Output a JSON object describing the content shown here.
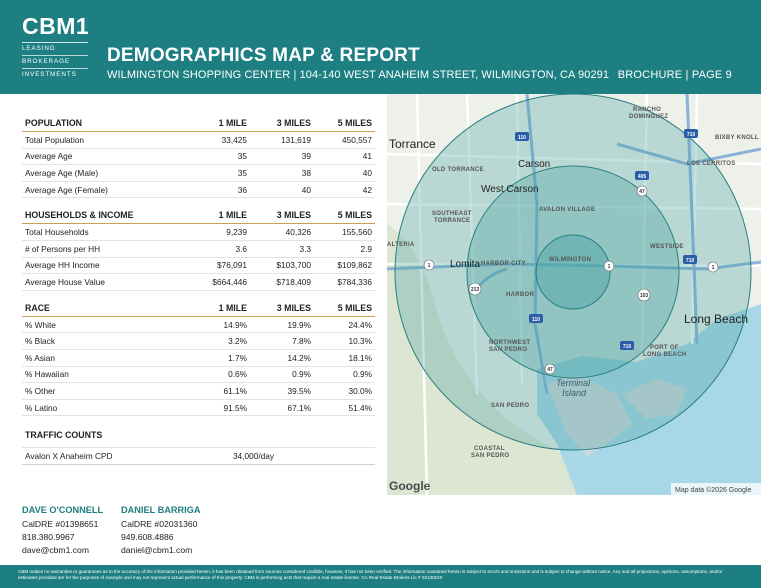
{
  "header": {
    "logo": {
      "name": "CBM1",
      "lines": [
        "LEASING",
        "BROKERAGE",
        "INVESTMENTS"
      ]
    },
    "title": "DEMOGRAPHICS MAP & REPORT",
    "subtitle": "WILMINGTON SHOPPING CENTER | 104-140 WEST ANAHEIM STREET, WILMINGTON, CA 90291",
    "page": "BROCHURE | PAGE 9",
    "accent": "#1e7f82",
    "rule_color": "#c9a24e"
  },
  "tables": {
    "population": {
      "headers": [
        "POPULATION",
        "1 MILE",
        "3 MILES",
        "5 MILES"
      ],
      "rows": [
        [
          "Total Population",
          "33,425",
          "131,619",
          "450,557"
        ],
        [
          "Average Age",
          "35",
          "39",
          "41"
        ],
        [
          "Average Age (Male)",
          "35",
          "38",
          "40"
        ],
        [
          "Average Age (Female)",
          "36",
          "40",
          "42"
        ]
      ]
    },
    "households": {
      "headers": [
        "HOUSEHOLDS & INCOME",
        "1 MILE",
        "3 MILES",
        "5 MILES"
      ],
      "rows": [
        [
          "Total Households",
          "9,239",
          "40,326",
          "155,560"
        ],
        [
          "# of Persons per HH",
          "3.6",
          "3.3",
          "2.9"
        ],
        [
          "Average HH Income",
          "$76,091",
          "$103,700",
          "$109,862"
        ],
        [
          "Average House Value",
          "$664,446",
          "$718,409",
          "$784,336"
        ]
      ]
    },
    "race": {
      "headers": [
        "RACE",
        "1 MILE",
        "3 MILES",
        "5 MILES"
      ],
      "rows": [
        [
          "% White",
          "14.9%",
          "19.9%",
          "24.4%"
        ],
        [
          "% Black",
          "3.2%",
          "7.8%",
          "10.3%"
        ],
        [
          "% Asian",
          "1.7%",
          "14.2%",
          "18.1%"
        ],
        [
          "% Hawaiian",
          "0.6%",
          "0.9%",
          "0.9%"
        ],
        [
          "% Other",
          "61.1%",
          "39.5%",
          "30.0%"
        ],
        [
          "% Latino",
          "91.5%",
          "67.1%",
          "51.4%"
        ]
      ]
    },
    "traffic": {
      "header": "TRAFFIC COUNTS",
      "label": "Avalon X Anaheim CPD",
      "value": "34,000/day"
    }
  },
  "map": {
    "place_labels": {
      "torrance": "Torrance",
      "carson": "Carson",
      "west_carson": "West Carson",
      "lomita": "Lomita",
      "long_beach": "Long Beach",
      "terminal_island_1": "Terminal",
      "terminal_island_2": "Island",
      "rancho_dominguez_1": "RANCHO",
      "rancho_dominguez_2": "DOMINGUEZ",
      "bixby_knolls": "BIXBY KNOLL",
      "old_torrance": "OLD TORRANCE",
      "los_cerritos": "LOS CERRITOS",
      "avalon_village": "AVALON VILLAGE",
      "southeast_torrance_1": "SOUTHEAST",
      "southeast_torrance_2": "TORRANCE",
      "westside": "WESTSIDE",
      "walteria": "ALTERIA",
      "harbor_city": "HARBOR CITY",
      "wilmington": "WILMINGTON",
      "harbor": "HARBOR",
      "northwest_san_pedro_1": "NORTHWEST",
      "northwest_san_pedro_2": "SAN PEDRO",
      "port_of_long_beach_1": "PORT OF",
      "port_of_long_beach_2": "LONG BEACH",
      "san_pedro": "SAN PEDRO",
      "coastal_san_pedro_1": "COASTAL",
      "coastal_san_pedro_2": "SAN PEDRO",
      "google": "Google",
      "attribution": "Map data ©2026 Google"
    },
    "route_shields": {
      "i110_north": "110",
      "i405": "405",
      "r47_north": "47",
      "r1_west": "1",
      "r1_mid": "1",
      "r1_east": "1",
      "i710_north": "710",
      "i710_mid": "710",
      "i710_south": "710",
      "r213": "213",
      "r103": "103",
      "i110_south": "110",
      "r47_south": "47"
    },
    "colors": {
      "land": "#eef1ea",
      "water": "#a8d8e8",
      "radius_fill": "#4aa3a3",
      "radius_stroke": "#2a7f80"
    }
  },
  "contacts": [
    {
      "name": "DAVE O'CONNELL",
      "license": "CalDRE #01398651",
      "phone": "818.380.9967",
      "email": "dave@cbm1.com"
    },
    {
      "name": "DANIEL BARRIGA",
      "license": "CalDRE #02031360",
      "phone": "949.608.4886",
      "email": "daniel@cbm1.com"
    }
  ],
  "footer": {
    "disclaimer": "CBM makes no warranties or guarantees as to the accuracy of the information provided herein, it has been obtained from sources considered credible, however, it has not been verified. The information contained herein is subject to errors and omissions and is subject to change without notice. Any and all projections, opinions, assumptions, and/or estimates provided are for the purposes of example and may not represent actual performance of this property. CBM is performing acts that require a real estate license. CA Real Estate Brokers Lic # 02130240"
  }
}
